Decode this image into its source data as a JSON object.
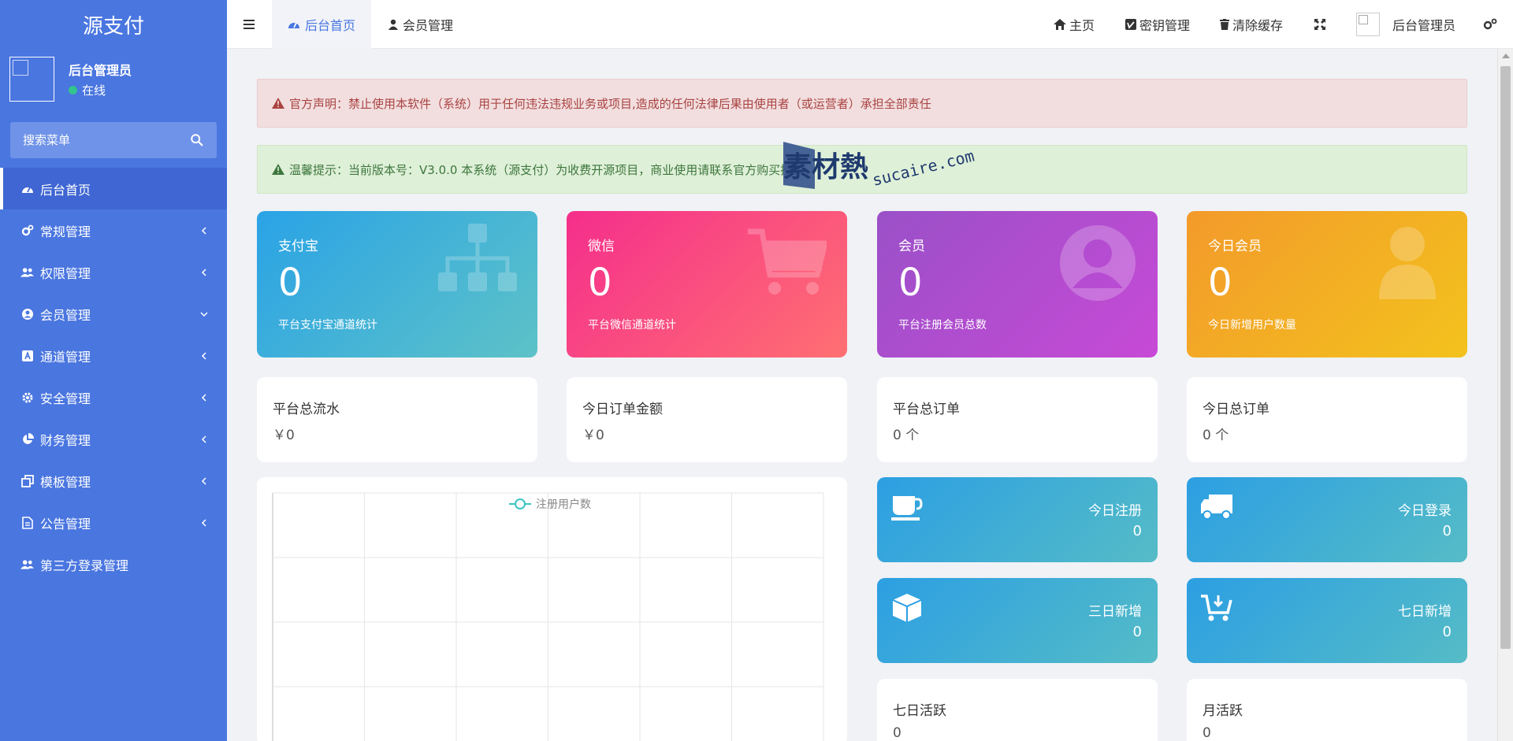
{
  "colors": {
    "sidebar": "#4a76e0",
    "sidebar_active": "#3f66d3",
    "accent": "#4a76e0",
    "status_online": "#33c38c"
  },
  "sidebar": {
    "brand": "源支付",
    "user": {
      "name": "后台管理员",
      "status": "在线"
    },
    "search": {
      "placeholder": "搜索菜单"
    },
    "items": [
      {
        "label": "后台首页",
        "icon": "dashboard-icon",
        "active": true
      },
      {
        "label": "常规管理",
        "icon": "cogs-icon",
        "arrow": "left"
      },
      {
        "label": "权限管理",
        "icon": "users-icon",
        "arrow": "left"
      },
      {
        "label": "会员管理",
        "icon": "user-circle-icon",
        "arrow": "down"
      },
      {
        "label": "通道管理",
        "icon": "channel-icon",
        "arrow": "left"
      },
      {
        "label": "安全管理",
        "icon": "gear-icon",
        "arrow": "left"
      },
      {
        "label": "财务管理",
        "icon": "pie-chart-icon",
        "arrow": "left"
      },
      {
        "label": "模板管理",
        "icon": "clone-icon",
        "arrow": "left"
      },
      {
        "label": "公告管理",
        "icon": "document-icon",
        "arrow": "left"
      },
      {
        "label": "第三方登录管理",
        "icon": "users-icon"
      }
    ]
  },
  "topbar": {
    "tabs": [
      {
        "label": "后台首页",
        "icon": "dashboard-icon"
      },
      {
        "label": "会员管理",
        "icon": "user-icon"
      }
    ],
    "right": {
      "home": "主页",
      "keys": "密钥管理",
      "clear_cache": "清除缓存",
      "admin": "后台管理员"
    }
  },
  "alerts": {
    "danger": "官方声明：禁止使用本软件（系统）用于任何违法违规业务或项目,造成的任何法律后果由使用者（或运营者）承担全部责任",
    "success": "温馨提示：当前版本号：V3.0.0 本系统（源支付）为收费开源项目，商业使用请联系官方购买授权"
  },
  "stat_cards": [
    {
      "title": "支付宝",
      "value": "0",
      "desc": "平台支付宝通道统计",
      "icon": "sitemap-icon"
    },
    {
      "title": "微信",
      "value": "0",
      "desc": "平台微信通道统计",
      "icon": "cart-icon"
    },
    {
      "title": "会员",
      "value": "0",
      "desc": "平台注册会员总数",
      "icon": "user-circle-icon"
    },
    {
      "title": "今日会员",
      "value": "0",
      "desc": "今日新增用户数量",
      "icon": "user-icon"
    }
  ],
  "info_cards": [
    {
      "title": "平台总流水",
      "value": "￥0"
    },
    {
      "title": "今日订单金额",
      "value": "￥0"
    },
    {
      "title": "平台总订单",
      "value": "0 个"
    },
    {
      "title": "今日总订单",
      "value": "0 个"
    }
  ],
  "mini_cards": [
    {
      "title": "今日注册",
      "value": "0",
      "icon": "coffee-icon"
    },
    {
      "title": "今日登录",
      "value": "0",
      "icon": "truck-icon"
    },
    {
      "title": "三日新增",
      "value": "0",
      "icon": "cube-icon"
    },
    {
      "title": "七日新增",
      "value": "0",
      "icon": "cart-download-icon"
    }
  ],
  "bottom_cards": [
    {
      "title": "七日活跃",
      "value": "0"
    },
    {
      "title": "月活跃",
      "value": "0"
    }
  ],
  "chart_data": {
    "type": "line",
    "series": [
      {
        "name": "注册用户数",
        "values": []
      }
    ],
    "legend": "top-center",
    "grid": true
  },
  "watermark": {
    "main": "素材熱",
    "sub": "sucaire.com"
  }
}
